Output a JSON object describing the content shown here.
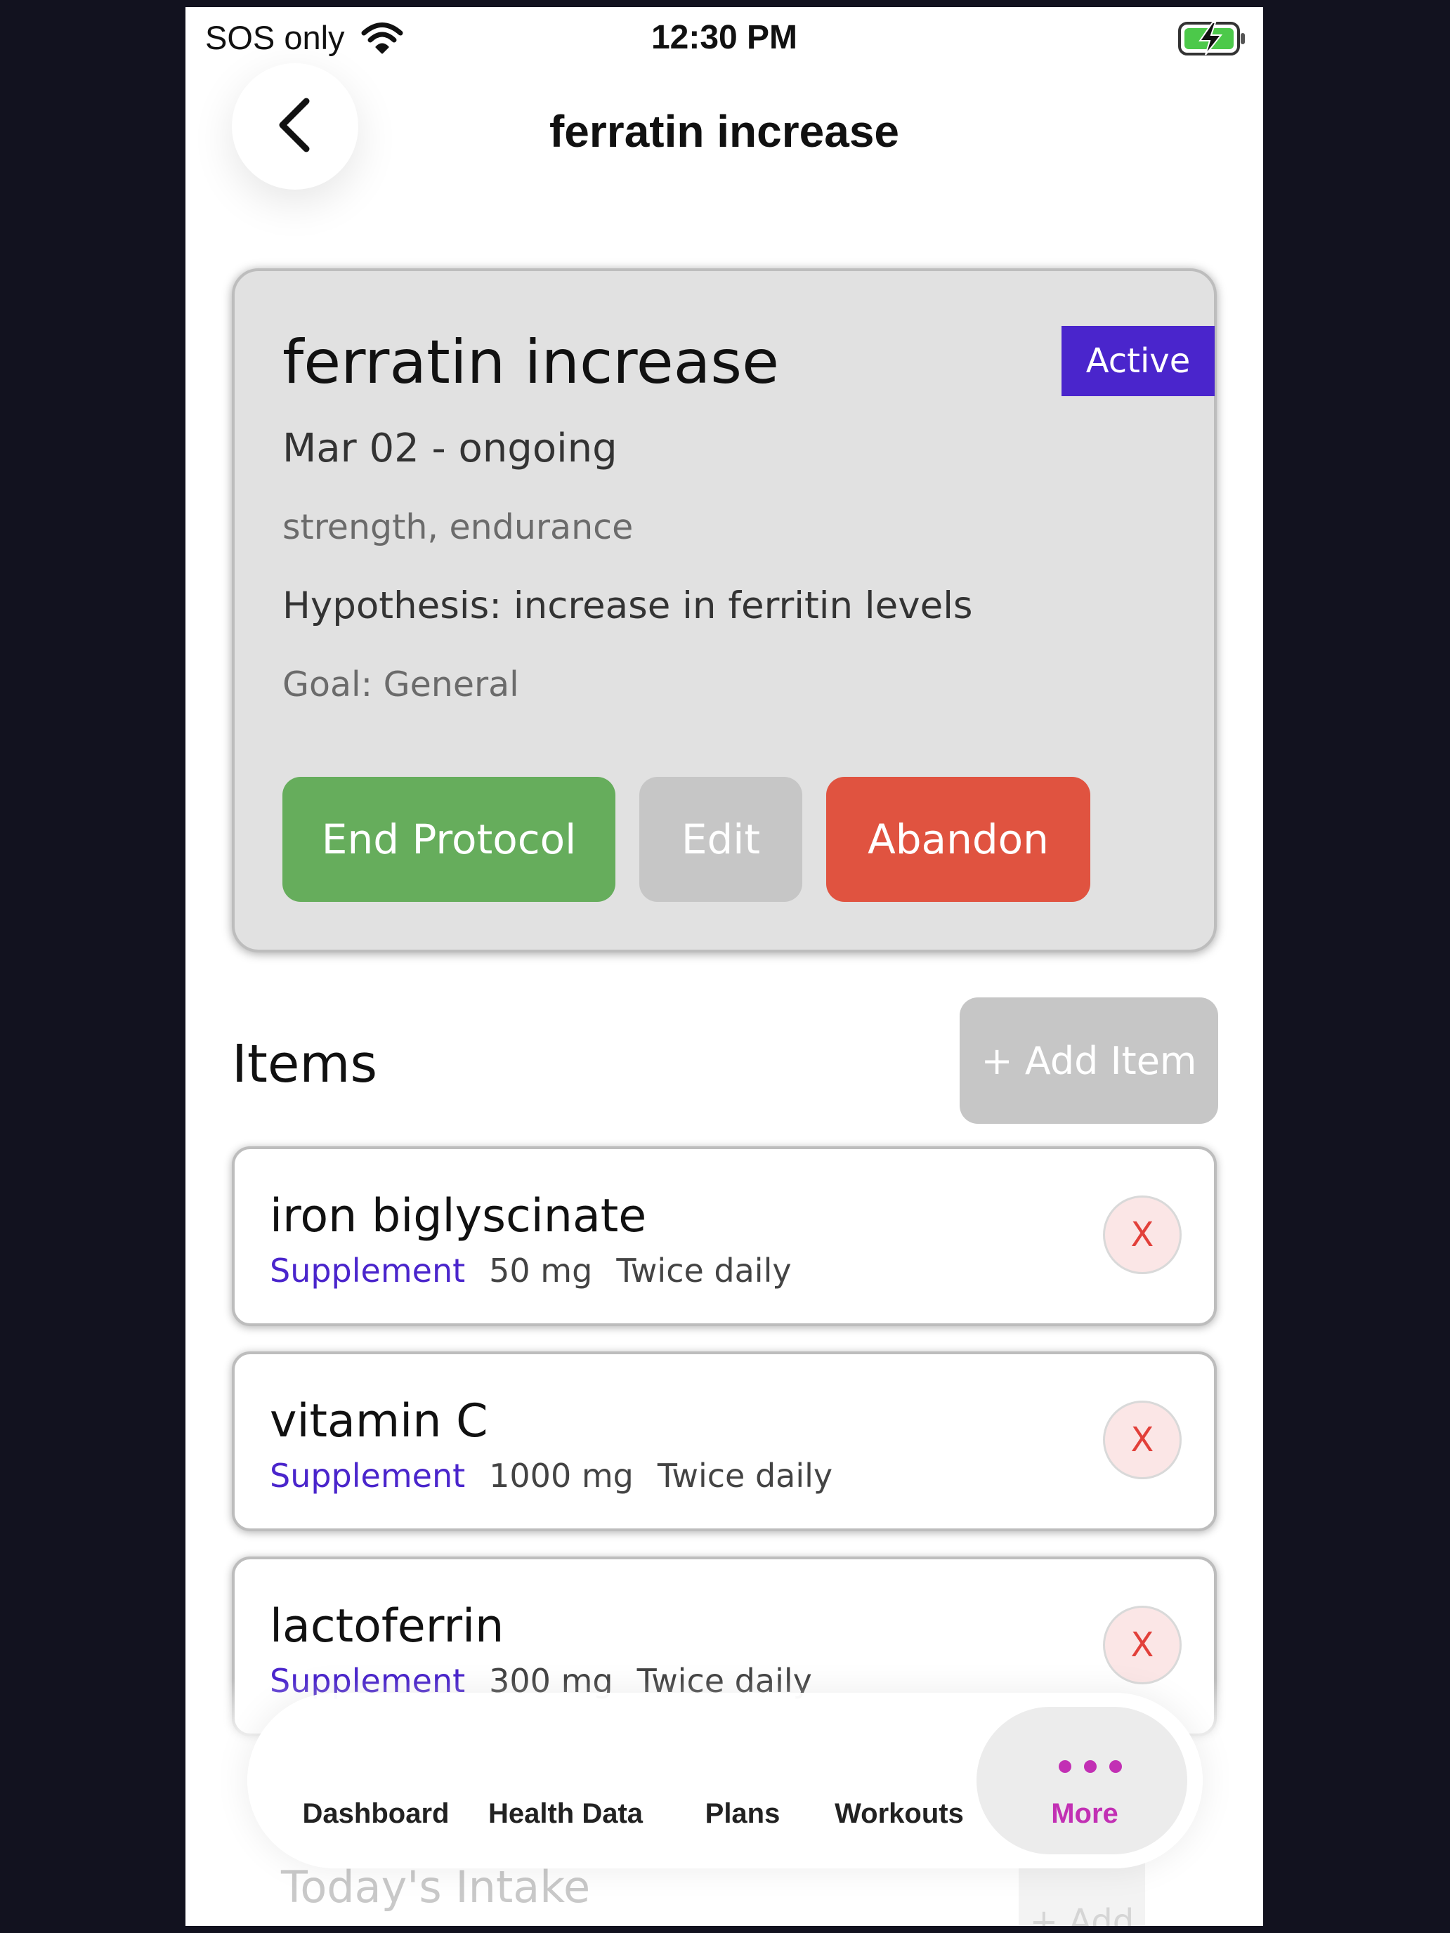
{
  "status_bar": {
    "carrier": "SOS only",
    "time": "12:30 PM",
    "wifi_icon": "wifi-icon",
    "battery_icon": "battery-charging-icon"
  },
  "header": {
    "back_icon": "chevron-left-icon",
    "title": "ferratin increase"
  },
  "protocol": {
    "title": "ferratin increase",
    "status": "Active",
    "dates": "Mar 02 - ongoing",
    "tags": "strength, endurance",
    "hypothesis": "Hypothesis: increase in ferritin levels",
    "goal": "Goal: General",
    "buttons": {
      "end": "End Protocol",
      "edit": "Edit",
      "abandon": "Abandon"
    }
  },
  "items_section": {
    "heading": "Items",
    "add_label": "+ Add Item",
    "items": [
      {
        "name": "iron biglyscinate",
        "type": "Supplement",
        "dose": "50 mg",
        "frequency": "Twice daily",
        "remove_label": "X"
      },
      {
        "name": "vitamin C",
        "type": "Supplement",
        "dose": "1000 mg",
        "frequency": "Twice daily",
        "remove_label": "X"
      },
      {
        "name": "lactoferrin",
        "type": "Supplement",
        "dose": "300 mg",
        "frequency": "Twice daily",
        "remove_label": "X"
      }
    ]
  },
  "today_section": {
    "heading": "Today's Intake",
    "add_label": "+ Add"
  },
  "tab_bar": {
    "tabs": [
      "Dashboard",
      "Health Data",
      "Plans",
      "Workouts",
      "More"
    ],
    "active": "More",
    "more_icon": "more-dots-icon"
  },
  "colors": {
    "accent_purple": "#4a25cc",
    "success_green": "#66ad5c",
    "danger_red": "#e05340",
    "active_tab": "#c230b4",
    "card_bg": "#e1e1e1",
    "outer_bg": "#12121f"
  }
}
